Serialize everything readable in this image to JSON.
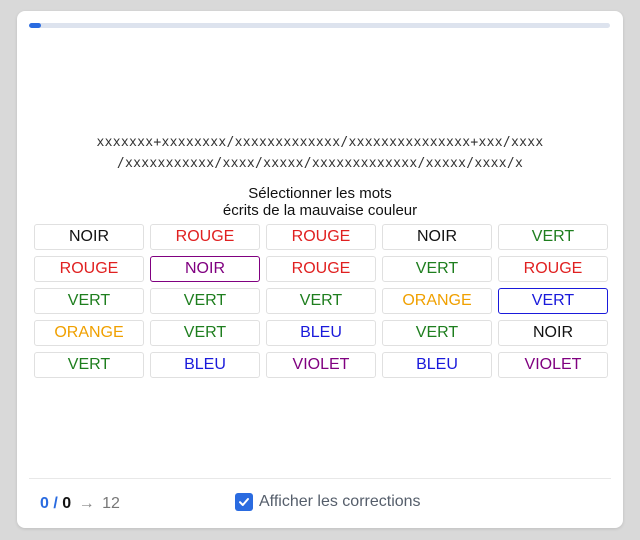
{
  "progress": {
    "fraction": 0.02
  },
  "sequence": {
    "line1": "xxxxxxx+xxxxxxxx/xxxxxxxxxxxxx/xxxxxxxxxxxxxxx+xxx/xxxx",
    "line2": "/xxxxxxxxxxx/xxxx/xxxxx/xxxxxxxxxxxxx/xxxxx/xxxx/x"
  },
  "instruction": {
    "line1": "Sélectionner les mots",
    "line2": "écrits de la mauvaise couleur"
  },
  "colors": {
    "black": "#111111",
    "red": "#e02020",
    "green": "#1e7e1e",
    "orange": "#f0a000",
    "blue": "#1a1adb",
    "purple": "#800080",
    "accent": "#2a6be0"
  },
  "grid": {
    "cells": [
      {
        "word": "NOIR",
        "color": "#111111",
        "selected": false
      },
      {
        "word": "ROUGE",
        "color": "#e02020",
        "selected": false
      },
      {
        "word": "ROUGE",
        "color": "#e02020",
        "selected": false
      },
      {
        "word": "NOIR",
        "color": "#111111",
        "selected": false
      },
      {
        "word": "VERT",
        "color": "#1e7e1e",
        "selected": false
      },
      {
        "word": "ROUGE",
        "color": "#e02020",
        "selected": false
      },
      {
        "word": "NOIR",
        "color": "#800080",
        "selected": true,
        "border": "#800080"
      },
      {
        "word": "ROUGE",
        "color": "#e02020",
        "selected": false
      },
      {
        "word": "VERT",
        "color": "#1e7e1e",
        "selected": false
      },
      {
        "word": "ROUGE",
        "color": "#e02020",
        "selected": false
      },
      {
        "word": "VERT",
        "color": "#1e7e1e",
        "selected": false
      },
      {
        "word": "VERT",
        "color": "#1e7e1e",
        "selected": false
      },
      {
        "word": "VERT",
        "color": "#1e7e1e",
        "selected": false
      },
      {
        "word": "ORANGE",
        "color": "#f0a000",
        "selected": false
      },
      {
        "word": "VERT",
        "color": "#1a1adb",
        "selected": true,
        "border": "#1a1adb"
      },
      {
        "word": "ORANGE",
        "color": "#f0a000",
        "selected": false
      },
      {
        "word": "VERT",
        "color": "#1e7e1e",
        "selected": false
      },
      {
        "word": "BLEU",
        "color": "#1a1adb",
        "selected": false
      },
      {
        "word": "VERT",
        "color": "#1e7e1e",
        "selected": false
      },
      {
        "word": "NOIR",
        "color": "#111111",
        "selected": false
      },
      {
        "word": "VERT",
        "color": "#1e7e1e",
        "selected": false
      },
      {
        "word": "BLEU",
        "color": "#1a1adb",
        "selected": false
      },
      {
        "word": "VIOLET",
        "color": "#800080",
        "selected": false
      },
      {
        "word": "BLEU",
        "color": "#1a1adb",
        "selected": false
      },
      {
        "word": "VIOLET",
        "color": "#800080",
        "selected": false
      }
    ]
  },
  "footer": {
    "score": {
      "correct": "0",
      "slash": " / ",
      "total": "0",
      "arrow": "→",
      "target": "12"
    },
    "toggle": {
      "label": "Afficher les corrections",
      "checked": true,
      "icon": "checkmark-icon"
    }
  }
}
